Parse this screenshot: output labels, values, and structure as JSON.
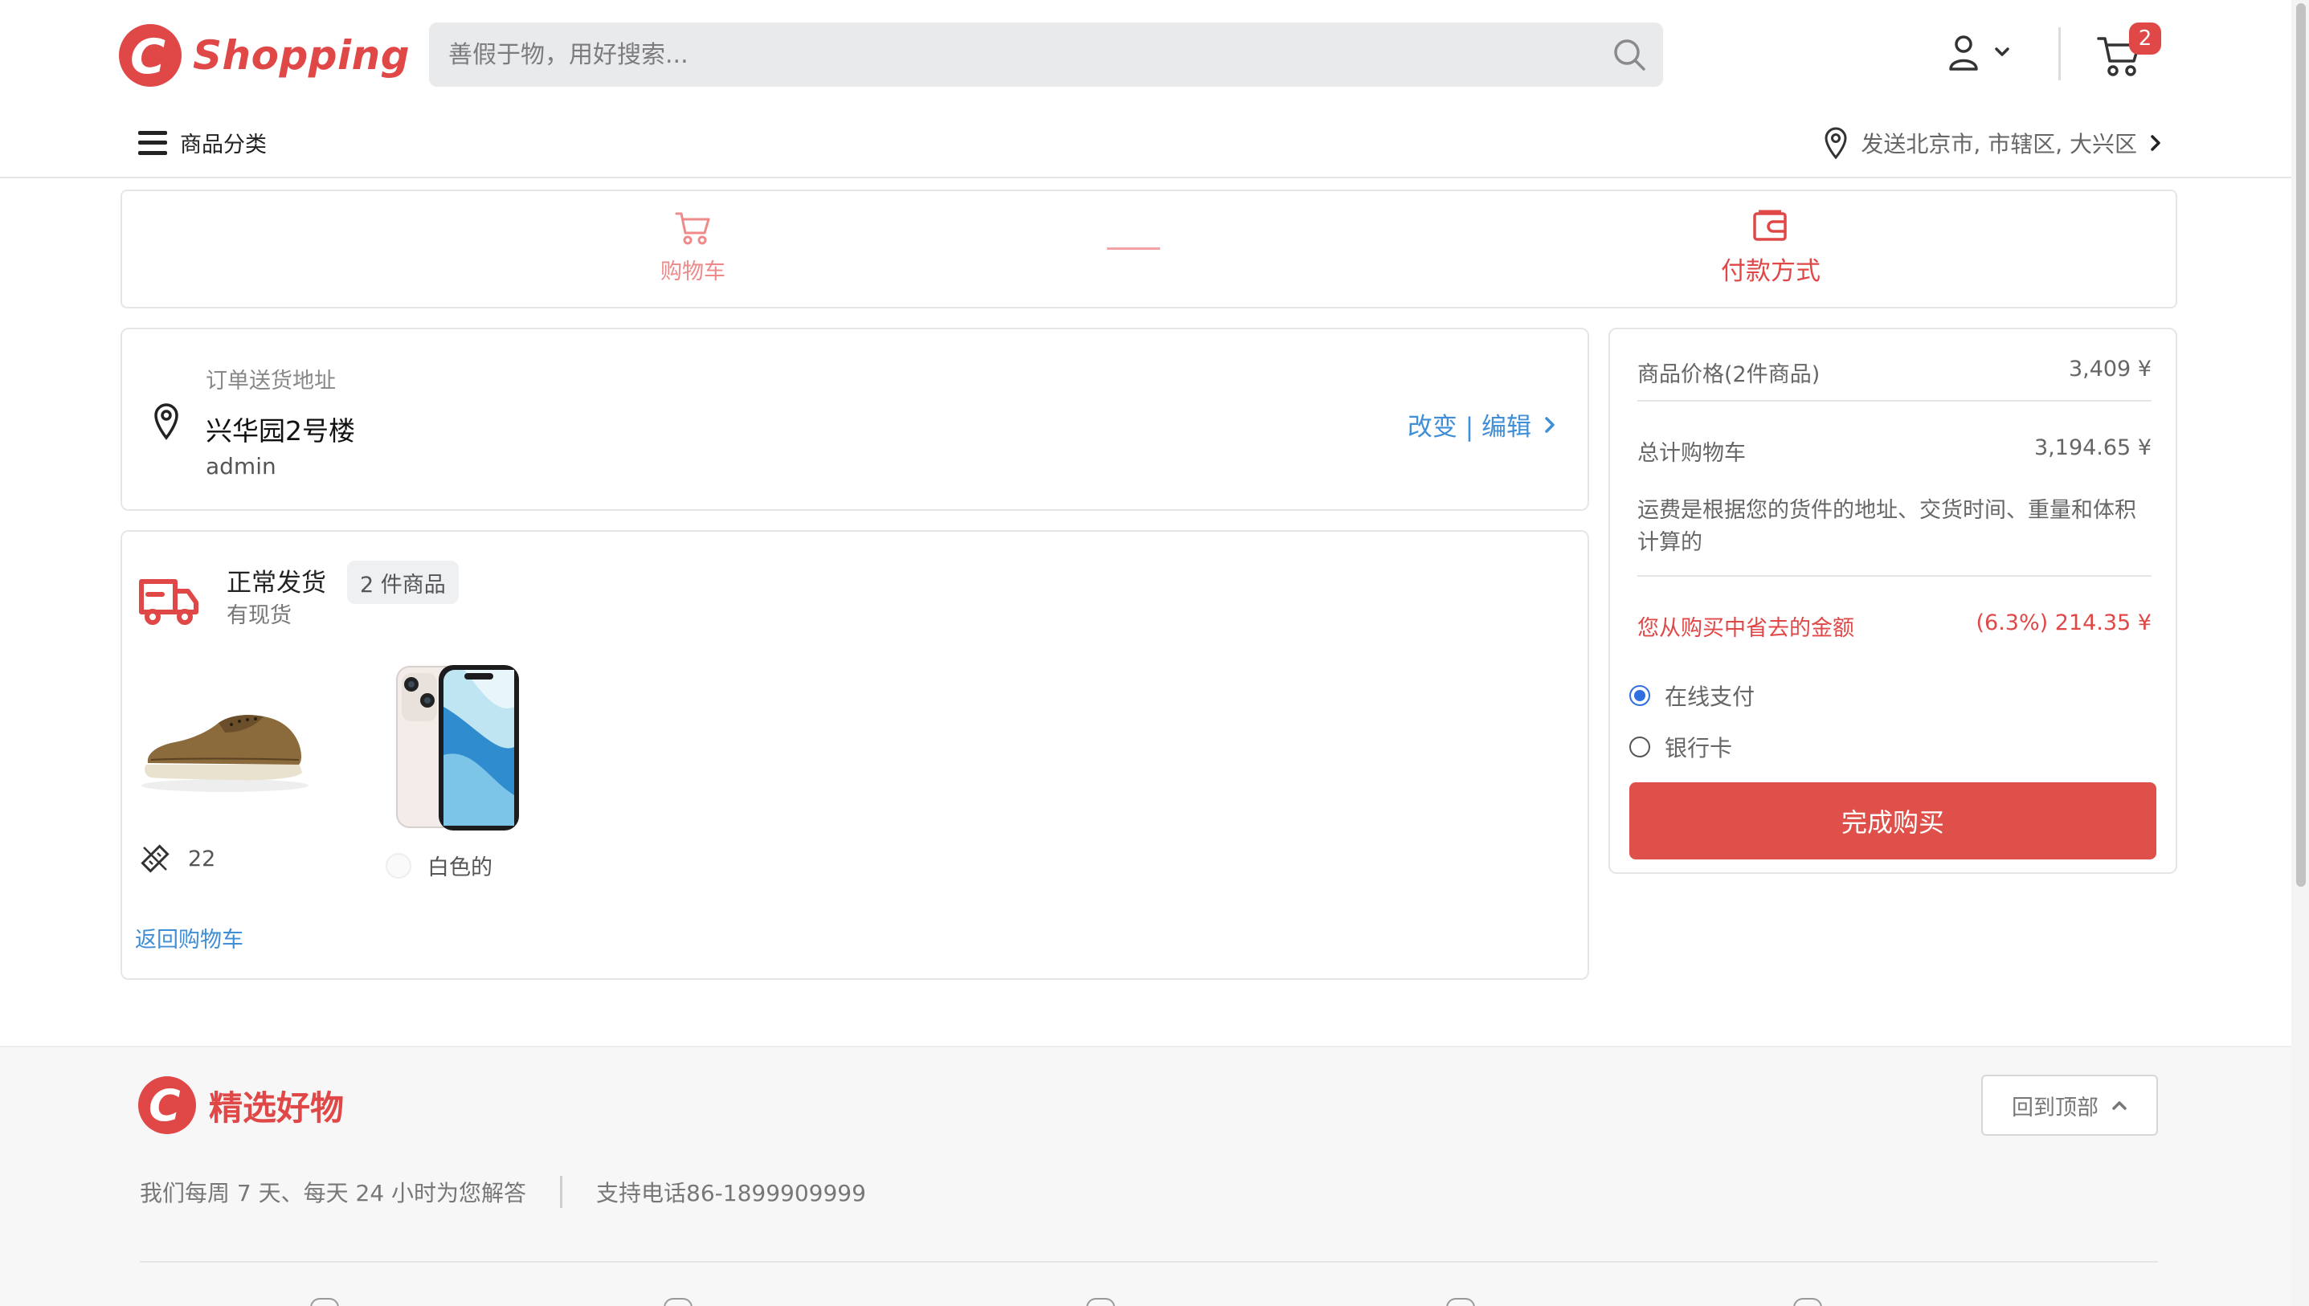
{
  "header": {
    "logo_text": "Shopping",
    "search_placeholder": "善假于物，用好搜索...",
    "cart_count": "2",
    "category_label": "商品分类",
    "ship_to": "发送北京市, 市辖区, 大兴区"
  },
  "steps": {
    "cart_label": "购物车",
    "payment_label": "付款方式"
  },
  "address": {
    "section_label": "订单送货地址",
    "name": "兴华园2号楼",
    "user": "admin",
    "edit_label": "改变 | 编辑"
  },
  "shipment": {
    "title": "正常发货",
    "subtitle": "有现货",
    "count_label": "2 件商品",
    "items": [
      {
        "name": "shoe",
        "attr": "22"
      },
      {
        "name": "phone",
        "attr": "白色的"
      }
    ],
    "back_label": "返回购物车"
  },
  "summary": {
    "price_label": "商品价格(2件商品)",
    "price_value": "3,409 ¥",
    "total_label": "总计购物车",
    "total_value": "3,194.65 ¥",
    "shipping_note": "运费是根据您的货件的地址、交货时间、重量和体积计算的",
    "saved_label": "您从购买中省去的金额",
    "saved_value": "(6.3%) 214.35  ¥",
    "payment_options": [
      {
        "label": "在线支付",
        "selected": true
      },
      {
        "label": "银行卡",
        "selected": false
      }
    ],
    "buy_label": "完成购买"
  },
  "footer": {
    "title": "精选好物",
    "to_top_label": "回到顶部",
    "service_hours": "我们每周 7 天、每天 24 小时为您解答",
    "support_phone": "支持电话86-1899909999"
  },
  "colors": {
    "brand": "#e04848",
    "link": "#3f8ed6",
    "radio_selected": "#2f6fe0"
  }
}
